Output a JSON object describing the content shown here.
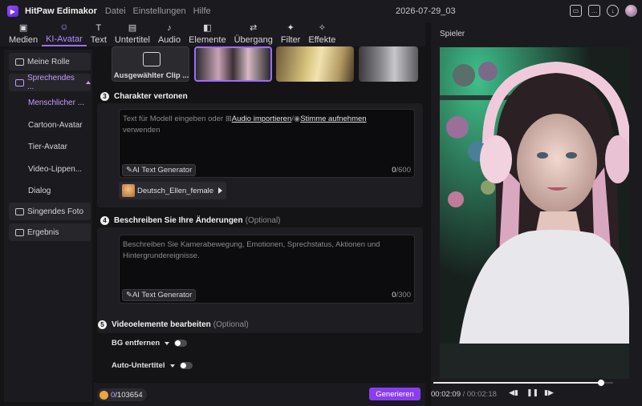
{
  "app": {
    "name": "HitPaw Edimakor",
    "project_name": "2026-07-29_03"
  },
  "menu": [
    "Datei",
    "Einstellungen",
    "Hilfe"
  ],
  "toolbar": [
    {
      "label": "Medien",
      "icon": "media-icon"
    },
    {
      "label": "KI-Avatar",
      "icon": "ai-avatar-icon",
      "active": true
    },
    {
      "label": "Text",
      "icon": "text-icon"
    },
    {
      "label": "Untertitel",
      "icon": "subtitle-icon"
    },
    {
      "label": "Audio",
      "icon": "audio-icon"
    },
    {
      "label": "Elemente",
      "icon": "elements-icon"
    },
    {
      "label": "Übergang",
      "icon": "transition-icon"
    },
    {
      "label": "Filter",
      "icon": "filter-icon"
    },
    {
      "label": "Effekte",
      "icon": "effects-icon"
    }
  ],
  "sidebar": {
    "items": [
      {
        "label": "Meine Rolle"
      },
      {
        "label": "Sprechendes ...",
        "active": true
      },
      {
        "label": "Singendes Foto"
      },
      {
        "label": "Ergebnis"
      }
    ],
    "sub_items": [
      {
        "label": "Menschlicher ...",
        "active": true
      },
      {
        "label": "Cartoon-Avatar"
      },
      {
        "label": "Tier-Avatar"
      },
      {
        "label": "Video-Lippen..."
      },
      {
        "label": "Dialog"
      }
    ]
  },
  "clip": {
    "selected_label": "Ausgewählter Clip ..."
  },
  "section3": {
    "number": "3",
    "title": "Charakter vertonen",
    "placeholder_start": "Text für Modell eingeben oder",
    "import_audio": "Audio importieren",
    "separator": "/",
    "record_voice": "Stimme aufnehmen",
    "placeholder_end": "verwenden",
    "ai_generator": "AI Text Generator",
    "count": "0",
    "max": "/600",
    "voice_name": "Deutsch_Ellen_female"
  },
  "section4": {
    "number": "4",
    "title": "Beschreiben Sie Ihre Änderungen",
    "optional": "(Optional)",
    "placeholder": "Beschreiben Sie Kamerabewegung, Emotionen, Sprechstatus, Aktionen und Hintergrundereignisse.",
    "ai_generator": "AI Text Generator",
    "count": "0",
    "max": "/300"
  },
  "section5": {
    "number": "5",
    "title": "Videoelemente bearbeiten",
    "optional": "(Optional)",
    "bg_remove": "BG entfernen",
    "auto_subtitle": "Auto-Untertitel"
  },
  "bottom": {
    "credits_used": "0",
    "credits_total": "/103654",
    "generate": "Generieren"
  },
  "player": {
    "title": "Spieler",
    "current_time": "00:02:09",
    "duration": "/ 00:02:18",
    "progress": 0.935
  },
  "colors": {
    "accent": "#a06cff",
    "generate_button": "#8a3df0"
  }
}
